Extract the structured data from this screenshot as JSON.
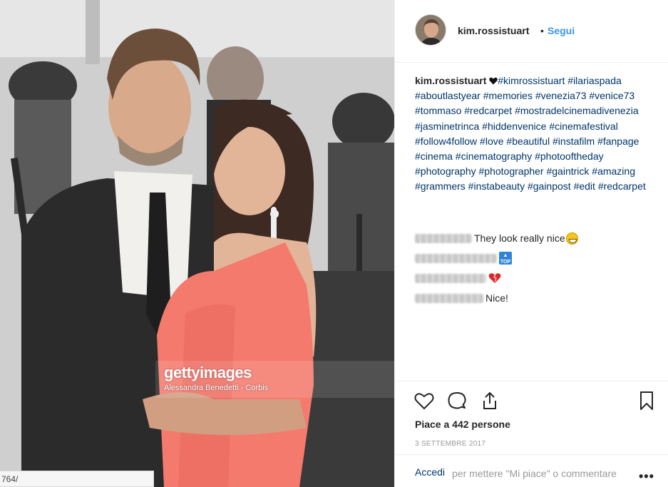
{
  "photo": {
    "watermark_logo": "gettyimages",
    "watermark_credit": "Alessandra Benedetti - Corbis",
    "url_tooltip": "764/"
  },
  "header": {
    "username": "kim.rossistuart",
    "separator": "•",
    "follow_label": "Segui"
  },
  "caption": {
    "username": "kim.rossistuart",
    "hashtags": "#kimrossistuart #ilariaspada #aboutlastyear #memories #venezia73 #venice73 #tommaso #redcarpet #mostradelcinemadivenezia #jasminetrinca #hiddenvenice #cinemafestival #follow4follow #love #beautiful #instafilm #fanpage #cinema #cinematography #photooftheday #photography #photographer #gaintrick #amazing #grammers #instabeauty #gainpost #edit #redcarpet"
  },
  "comments": [
    {
      "text": "They look really nice",
      "emoji": "grinning-face"
    },
    {
      "text": "",
      "emoji": "top-arrow"
    },
    {
      "text": "",
      "emoji": "red-heart"
    },
    {
      "text": "Nice!",
      "emoji": ""
    }
  ],
  "post": {
    "likes": "Piace a 442 persone",
    "date": "3 SETTEMBRE 2017",
    "login_link": "Accedi",
    "login_rest": "per mettere \"Mi piace\" o commentare",
    "more": "•••"
  },
  "icons": [
    "heart-icon",
    "comment-icon",
    "share-icon",
    "bookmark-icon"
  ],
  "colors": {
    "link_blue": "#3897f0",
    "hashtag": "#003569",
    "text": "#262626",
    "muted": "#999999",
    "dress": "#f47a6e"
  }
}
